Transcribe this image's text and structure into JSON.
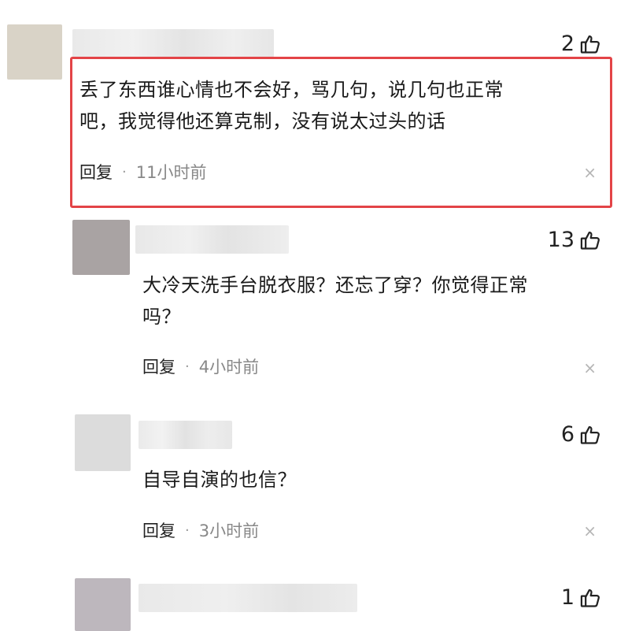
{
  "comments": [
    {
      "likes": "2",
      "text_lines": [
        "丢了东西谁心情也不会好，骂几句，说几句也正常",
        "吧，我觉得他还算克制，没有说太过头的话"
      ],
      "reply": "回复",
      "time": "11小时前",
      "highlighted": true
    },
    {
      "likes": "13",
      "text_lines": [
        "大冷天洗手台脱衣服？还忘了穿？你觉得正常",
        "吗？"
      ],
      "reply": "回复",
      "time": "4小时前"
    },
    {
      "likes": "6",
      "text_lines": [
        "自导自演的也信？"
      ],
      "reply": "回复",
      "time": "3小时前"
    },
    {
      "likes": "1"
    }
  ],
  "separator_dot": "·",
  "close_glyph": "×",
  "colors": {
    "highlight_border": "#e34447",
    "time_text": "#888888"
  },
  "icons": {
    "like": "thumbs-up-icon",
    "close": "close-icon"
  }
}
